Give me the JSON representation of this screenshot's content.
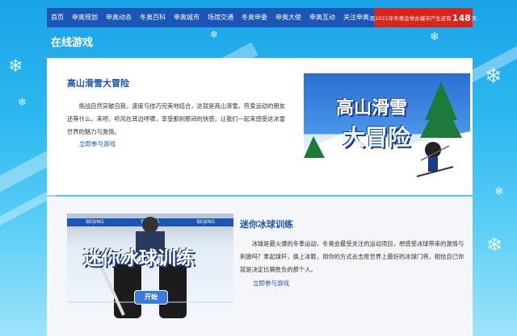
{
  "nav": {
    "items": [
      "首页",
      "申奥规划",
      "申奥动态",
      "冬奥百科",
      "申奥城市",
      "场馆交通",
      "冬奥申委",
      "申奥大使",
      "申奥互动",
      "关注申奥"
    ],
    "countdown_prefix": "距2022年冬奥会举办城市产生还有",
    "countdown_number": "148",
    "countdown_suffix": "天"
  },
  "section": {
    "title": "在线游戏"
  },
  "games": [
    {
      "title": "高山滑雪大冒险",
      "description": "挑战自然突破自我，速度与技巧完美地结合，这就是高山滑雪。热爱运动的朋友还等什么，来吧，听风在耳边呼啸，享受那刹那间的快感，让我们一起来感受这冰雪世界的魅力与激情。",
      "link": "立即参与游戏",
      "banner_text": [
        "高山滑雪",
        "大冒险"
      ]
    },
    {
      "title": "迷你冰球训练",
      "description": "冰球是最火爆的冬季运动，冬奥会最受关注的运动项目，想感受冰球带来的激情与刺激吗？拿起球杆，换上冰鞋，用你的方式去击败世界上最好的冰球门将，相信自己你就是决定比赛胜负的那个人。",
      "link": "立即参与游戏",
      "banner_text": "迷你冰球训练",
      "board_text": "BEIJING",
      "start_label": "开始"
    }
  ],
  "colors": {
    "nav_bg": "#1a56b8",
    "accent_red": "#d9261c",
    "link_blue": "#1a56b8"
  }
}
